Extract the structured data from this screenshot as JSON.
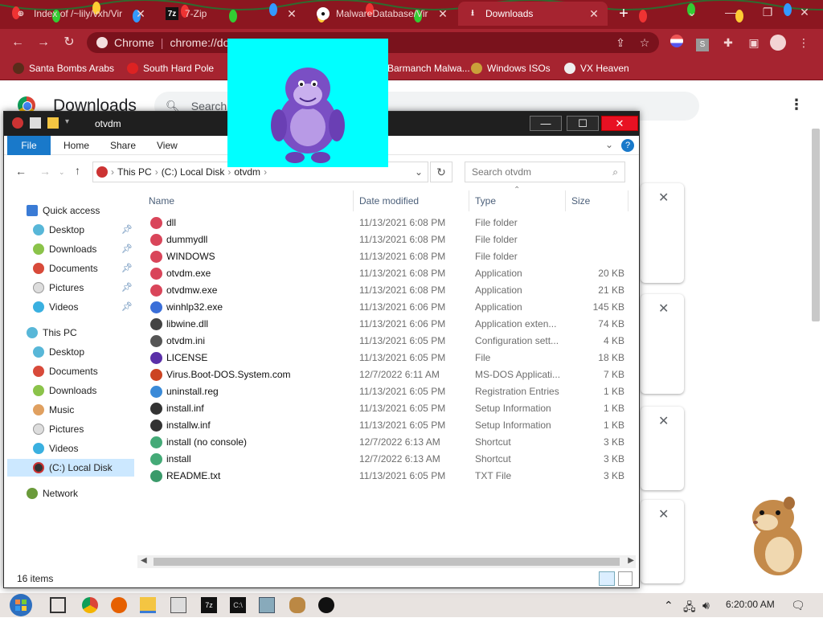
{
  "browser": {
    "tabs": [
      {
        "title": "Index of /~lily/vxh/Vir",
        "icon": "globe-icon",
        "active": false
      },
      {
        "title": "7-Zip",
        "icon": "7zip-icon",
        "active": false
      },
      {
        "title": "MalwareDatabase/Vir",
        "icon": "github-icon",
        "active": false
      },
      {
        "title": "Downloads",
        "icon": "download-icon",
        "active": true
      }
    ],
    "new_tab_label": "+",
    "omnibox_scheme": "Chrome",
    "omnibox_url": "chrome://downloads",
    "bookmarks": [
      {
        "label": "Santa Bombs Arabs"
      },
      {
        "label": "South Hard Pole"
      },
      {
        "label": "Barmanch Malwa..."
      },
      {
        "label": "Windows ISOs"
      },
      {
        "label": "VX Heaven"
      }
    ],
    "accent": "#a62430"
  },
  "downloads_page": {
    "title": "Downloads",
    "search_placeholder": "Search downloads"
  },
  "explorer": {
    "window_title": "otvdm",
    "ribbon_tabs": [
      "File",
      "Home",
      "Share",
      "View"
    ],
    "breadcrumb": [
      "This PC",
      "(C:) Local Disk",
      "otvdm"
    ],
    "search_placeholder": "Search otvdm",
    "nav": {
      "quick_access_label": "Quick access",
      "quick_access": [
        "Desktop",
        "Downloads",
        "Documents",
        "Pictures",
        "Videos"
      ],
      "this_pc_label": "This PC",
      "this_pc": [
        "Desktop",
        "Documents",
        "Downloads",
        "Music",
        "Pictures",
        "Videos",
        "(C:) Local Disk"
      ],
      "network_label": "Network",
      "selected": "(C:) Local Disk"
    },
    "columns": {
      "name": "Name",
      "date": "Date modified",
      "type": "Type",
      "size": "Size"
    },
    "files": [
      {
        "name": "dll",
        "date": "11/13/2021 6:08 PM",
        "type": "File folder",
        "size": "",
        "icon": "folder-icon"
      },
      {
        "name": "dummydll",
        "date": "11/13/2021 6:08 PM",
        "type": "File folder",
        "size": "",
        "icon": "folder-icon"
      },
      {
        "name": "WINDOWS",
        "date": "11/13/2021 6:08 PM",
        "type": "File folder",
        "size": "",
        "icon": "folder-icon"
      },
      {
        "name": "otvdm.exe",
        "date": "11/13/2021 6:08 PM",
        "type": "Application",
        "size": "20 KB",
        "icon": "app-icon"
      },
      {
        "name": "otvdmw.exe",
        "date": "11/13/2021 6:08 PM",
        "type": "Application",
        "size": "21 KB",
        "icon": "app-icon"
      },
      {
        "name": "winhlp32.exe",
        "date": "11/13/2021 6:06 PM",
        "type": "Application",
        "size": "145 KB",
        "icon": "help-icon"
      },
      {
        "name": "libwine.dll",
        "date": "11/13/2021 6:06 PM",
        "type": "Application exten...",
        "size": "74 KB",
        "icon": "dll-icon"
      },
      {
        "name": "otvdm.ini",
        "date": "11/13/2021 6:05 PM",
        "type": "Configuration sett...",
        "size": "4 KB",
        "icon": "ini-icon"
      },
      {
        "name": "LICENSE",
        "date": "11/13/2021 6:05 PM",
        "type": "File",
        "size": "18 KB",
        "icon": "file-icon"
      },
      {
        "name": "Virus.Boot-DOS.System.com",
        "date": "12/7/2022 6:11 AM",
        "type": "MS-DOS Applicati...",
        "size": "7 KB",
        "icon": "dos-icon"
      },
      {
        "name": "uninstall.reg",
        "date": "11/13/2021 6:05 PM",
        "type": "Registration Entries",
        "size": "1 KB",
        "icon": "reg-icon"
      },
      {
        "name": "install.inf",
        "date": "11/13/2021 6:05 PM",
        "type": "Setup Information",
        "size": "1 KB",
        "icon": "inf-icon"
      },
      {
        "name": "installw.inf",
        "date": "11/13/2021 6:05 PM",
        "type": "Setup Information",
        "size": "1 KB",
        "icon": "inf-icon"
      },
      {
        "name": "install (no console)",
        "date": "12/7/2022 6:13 AM",
        "type": "Shortcut",
        "size": "3 KB",
        "icon": "shortcut-icon"
      },
      {
        "name": "install",
        "date": "12/7/2022 6:13 AM",
        "type": "Shortcut",
        "size": "3 KB",
        "icon": "shortcut-icon"
      },
      {
        "name": "README.txt",
        "date": "11/13/2021 6:05 PM",
        "type": "TXT File",
        "size": "3 KB",
        "icon": "txt-icon"
      }
    ],
    "status": "16 items"
  },
  "taskbar": {
    "clock": "6:20:00 AM"
  }
}
